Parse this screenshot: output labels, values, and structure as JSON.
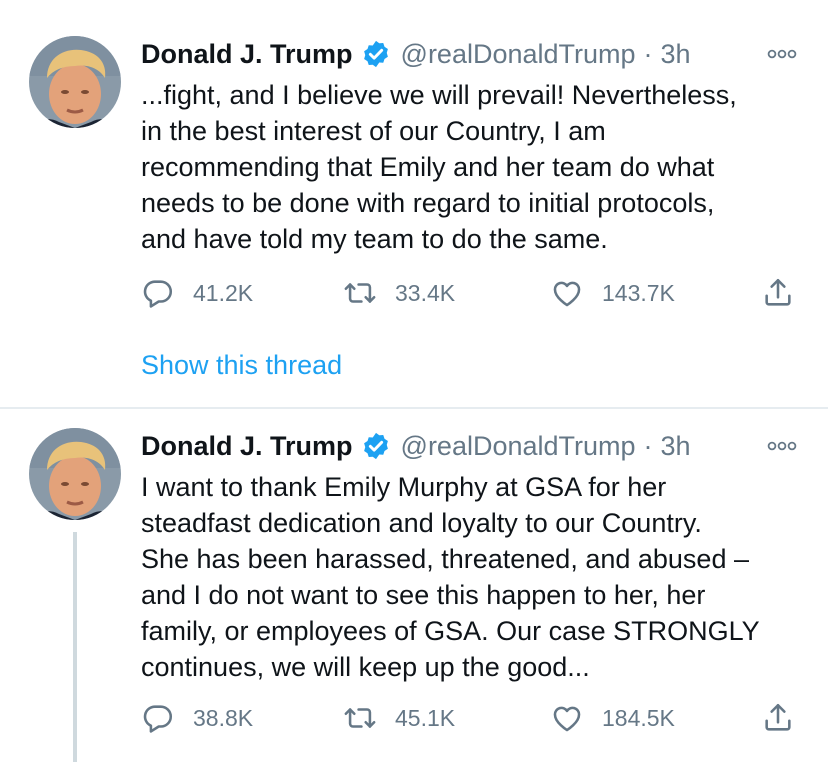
{
  "colors": {
    "accent": "#1da1f2",
    "text": "#0f1419",
    "secondary": "#657786",
    "divider": "#e6ecf0",
    "thread_line": "#cfd9de"
  },
  "tweets": [
    {
      "author_name": "Donald J. Trump",
      "verified_icon": "verified-badge-icon",
      "handle": "@realDonaldTrump",
      "separator": "·",
      "time": "3h",
      "text": "...fight, and I believe we will prevail! Nevertheless,\nin the best interest of our Country, I am\nrecommending that Emily and her team do what\nneeds to be done with regard to initial protocols,\nand have told my team to do the same.",
      "replies": "41.2K",
      "retweets": "33.4K",
      "likes": "143.7K",
      "show_thread": "Show this thread"
    },
    {
      "author_name": "Donald J. Trump",
      "verified_icon": "verified-badge-icon",
      "handle": "@realDonaldTrump",
      "separator": "·",
      "time": "3h",
      "text": "I want to thank Emily Murphy at GSA for her\nsteadfast dedication and loyalty to our Country.\nShe has been harassed, threatened, and abused –\nand I do not want to see this happen to her, her\nfamily, or employees of GSA. Our case STRONGLY\ncontinues, we will keep up the good...",
      "replies": "38.8K",
      "retweets": "45.1K",
      "likes": "184.5K"
    }
  ]
}
